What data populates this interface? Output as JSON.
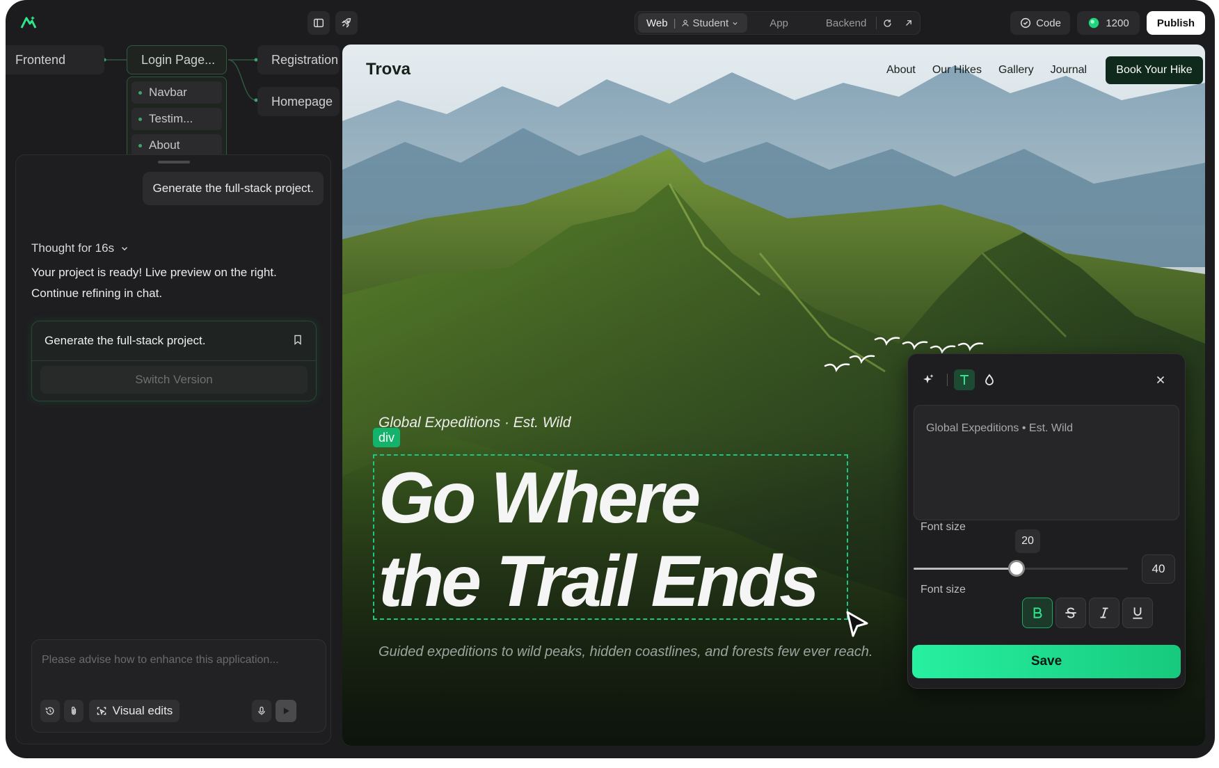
{
  "toolbar": {
    "segments": {
      "web": "Web",
      "student": "Student",
      "app": "App",
      "backend": "Backend"
    },
    "code_label": "Code",
    "credits": "1200",
    "publish_label": "Publish",
    "icons": [
      "sidebar-toggle-icon",
      "rocket-icon",
      "user-icon",
      "chevron-down-icon",
      "refresh-icon",
      "external-link-icon",
      "check-circle-icon",
      "coin-icon"
    ]
  },
  "flow": {
    "nodes": [
      "Frontend",
      "Login Page...",
      "Registration",
      "Homepage"
    ],
    "subnodes": [
      "Navbar",
      "Testim...",
      "About"
    ],
    "accent": "#3fa36c"
  },
  "chat": {
    "user_message": "Generate the full-stack project.",
    "thought_label": "Thought for 16s",
    "reply": "Your project is ready! Live preview on the right. Continue refining in chat.",
    "version_title": "Generate the full-stack project.",
    "switch_label": "Switch Version",
    "composer_placeholder": "Please advise how to enhance this application...",
    "visual_edits_label": "Visual edits"
  },
  "preview": {
    "brand": "Trova",
    "nav": [
      "About",
      "Our Hikes",
      "Gallery",
      "Journal"
    ],
    "cta": "Book Your Hike",
    "tagline": "Global Expeditions · Est. Wild",
    "selected_tag": "div",
    "headline_line1": "Go Where",
    "headline_line2": "the Trail Ends",
    "subtitle": "Guided expeditions to wild peaks, hidden coastlines, and forests few ever reach.",
    "selection_color": "#18c884"
  },
  "editor": {
    "text_value": "Global Expeditions • Est. Wild",
    "font_size_label": "Font size",
    "format_label": "Font size",
    "slider_value": "20",
    "slider_fraction": 0.48,
    "max_value": "40",
    "save_label": "Save",
    "bold_active": true,
    "accent": "#27f0a0"
  }
}
